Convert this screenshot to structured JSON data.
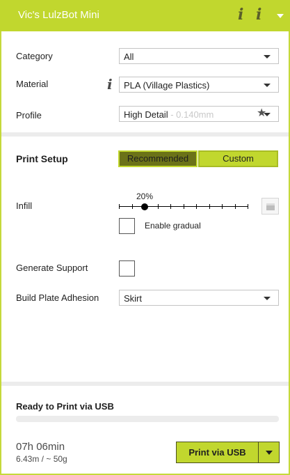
{
  "header": {
    "title": "Vic's LulzBot Mini",
    "info_glyph": "i",
    "icons": [
      "info-icon",
      "info-icon",
      "caret-down-icon"
    ]
  },
  "category": {
    "label": "Category",
    "value": "All"
  },
  "material": {
    "label": "Material",
    "value": "PLA (Village Plastics)",
    "info_glyph": "i"
  },
  "profile": {
    "label": "Profile",
    "value": "High Detail",
    "value_detail": " - 0.140mm",
    "star_glyph": "★"
  },
  "print_setup": {
    "title": "Print Setup",
    "tabs": [
      {
        "label": "Recommended",
        "selected": true
      },
      {
        "label": "Custom",
        "selected": false
      }
    ]
  },
  "infill": {
    "label": "Infill",
    "percent_label": "20%",
    "value_percent": 20,
    "range_percent": [
      0,
      100
    ],
    "tick_count": 11,
    "gradual": {
      "label": "Enable gradual",
      "checked": false
    }
  },
  "support": {
    "label": "Generate Support",
    "checked": false
  },
  "adhesion": {
    "label": "Build Plate Adhesion",
    "value": "Skirt"
  },
  "status": {
    "ready_text": "Ready to Print via USB",
    "progress_fraction": 0,
    "time": "07h 06min",
    "usage": "6.43m / ~ 50g",
    "print_button_label": "Print via USB"
  },
  "colors": {
    "accent": "#c1d72e",
    "accent_dark": "#6b7218",
    "separator": "#ececec"
  }
}
